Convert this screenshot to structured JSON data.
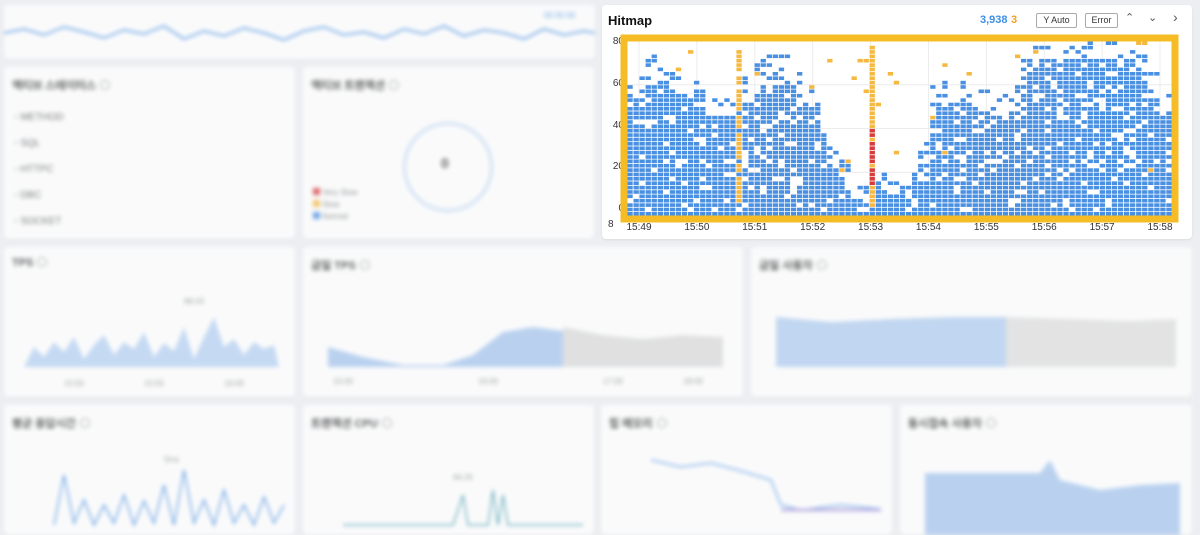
{
  "hitmap": {
    "title": "Hitmap",
    "count": "3,938",
    "error_count": "3",
    "y_auto_label": "Y Auto",
    "error_label": "Error",
    "up_icon": "chevron-up-icon",
    "down_icon": "chevron-down-icon",
    "next_icon": "chevron-right-icon",
    "y_ticks": [
      "80",
      "60",
      "40",
      "20",
      "0"
    ],
    "x_ticks": [
      "15:49",
      "15:50",
      "15:51",
      "15:52",
      "15:53",
      "15:54",
      "15:55",
      "15:56",
      "15:57",
      "15:58"
    ],
    "bottom_left_label": "8",
    "colors": {
      "normal": "#4a90e2",
      "slow": "#f5b942",
      "error": "#d93b3b",
      "highlight": "#f5bc26"
    }
  },
  "blurred_panels": {
    "top_strip": {
      "legend": "00 00 00"
    },
    "panel_1": {
      "title": "액티브 스테이터스",
      "items": [
        "METHOD",
        "SQL",
        "HTTPC",
        "DBC",
        "SOCKET"
      ]
    },
    "panel_2": {
      "title": "액티브 트랜잭션",
      "center_value": "0",
      "legend": [
        "Very Slow",
        "Slow",
        "Normal"
      ]
    },
    "panel_3": {
      "title": "TPS",
      "peak": "88.03",
      "x": [
        "15:50",
        "15:55",
        "16:00"
      ]
    },
    "panel_4": {
      "title": "금일 TPS",
      "x": [
        "15:00",
        "16:00",
        "17:00",
        "17:00",
        "18:00"
      ]
    },
    "panel_5": {
      "title": "금일 사용자"
    },
    "panel_6": {
      "title": "평균 응답시간",
      "peak": "5ms"
    },
    "panel_7": {
      "title": "트랜잭션 CPU",
      "peak": "94.25"
    },
    "panel_8": {
      "title": "힙 메모리"
    },
    "panel_9": {
      "title": "동시접속 사용자"
    }
  }
}
